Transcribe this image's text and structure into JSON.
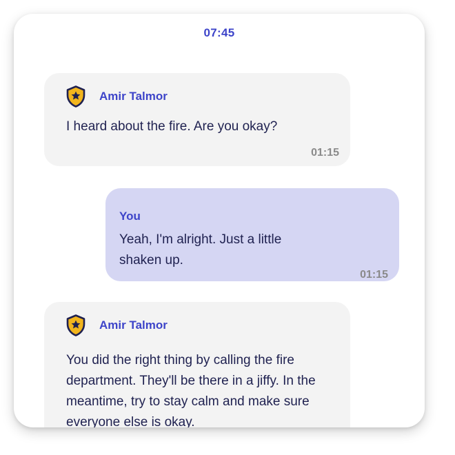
{
  "status_bar": {
    "time": "07:45"
  },
  "messages": [
    {
      "sender": "Amir Talmor",
      "icon": "police-badge-icon",
      "text": "I heard about the fire. Are you okay?",
      "time": "01:15"
    },
    {
      "sender": "You",
      "text": "Yeah, I'm alright. Just a little shaken up.",
      "time": "01:15"
    },
    {
      "sender": "Amir Talmor",
      "icon": "police-badge-icon",
      "text": "You did the right thing by calling the fire department. They'll be there in a jiffy. In the meantime, try to stay calm and make sure everyone else is okay."
    }
  ],
  "colors": {
    "accent": "#3d44c9",
    "incoming_bubble": "#f3f3f3",
    "outgoing_bubble": "#d5d6f3",
    "message_text": "#1f2150",
    "timestamp": "#8a8a8a",
    "badge_fill": "#f2b51d",
    "badge_outline": "#1f2150"
  }
}
